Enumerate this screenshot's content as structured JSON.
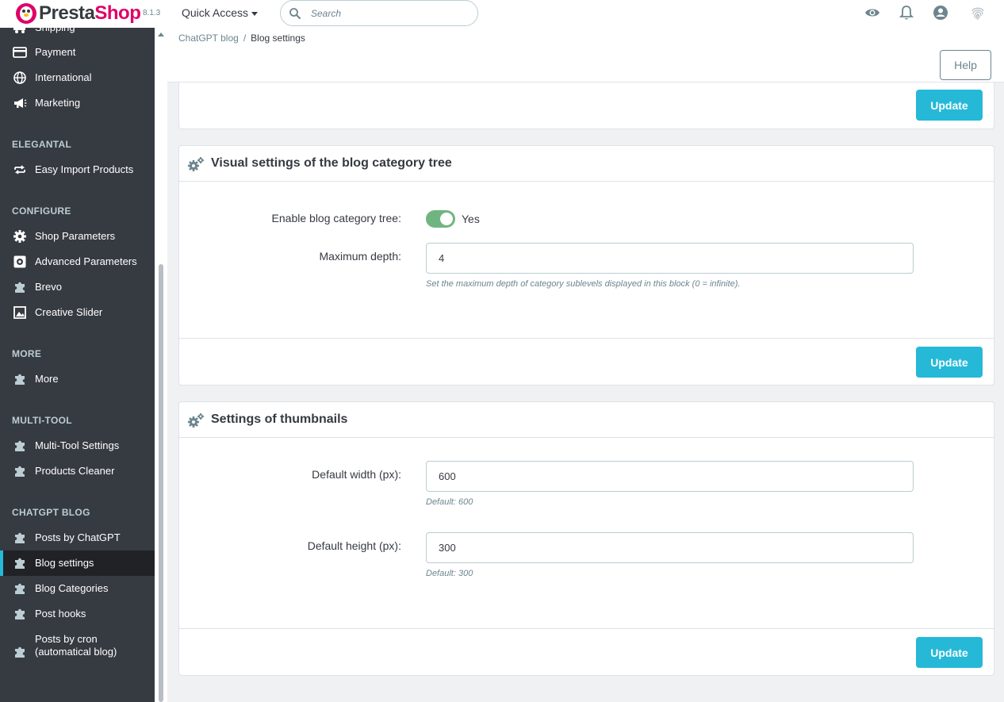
{
  "header": {
    "logo_part1": "Presta",
    "logo_part2": "Shop",
    "version": "8.1.3",
    "quick_access": "Quick Access",
    "search_placeholder": "Search",
    "icons": [
      "eye-icon",
      "bell-icon",
      "user-icon",
      "fingerprint-icon"
    ]
  },
  "sidebar": {
    "items_top": [
      {
        "label": "Shipping",
        "icon": "truck-icon"
      },
      {
        "label": "Payment",
        "icon": "credit-card-icon"
      },
      {
        "label": "International",
        "icon": "globe-icon"
      },
      {
        "label": "Marketing",
        "icon": "megaphone-icon"
      }
    ],
    "sections": {
      "elegantal": "ELEGANTAL",
      "configure": "CONFIGURE",
      "more": "MORE",
      "multitool": "MULTI-TOOL",
      "chatgpt": "CHATGPT BLOG"
    },
    "elegantal_items": [
      {
        "label": "Easy Import Products",
        "icon": "swap-icon"
      }
    ],
    "configure_items": [
      {
        "label": "Shop Parameters",
        "icon": "gear-icon"
      },
      {
        "label": "Advanced Parameters",
        "icon": "advanced-gear-icon"
      },
      {
        "label": "Brevo",
        "icon": "puzzle-icon"
      },
      {
        "label": "Creative Slider",
        "icon": "image-icon"
      }
    ],
    "more_items": [
      {
        "label": "More",
        "icon": "puzzle-icon"
      }
    ],
    "multitool_items": [
      {
        "label": "Multi-Tool Settings",
        "icon": "puzzle-icon"
      },
      {
        "label": "Products Cleaner",
        "icon": "puzzle-icon"
      }
    ],
    "chatgpt_items": [
      {
        "label": "Posts by ChatGPT",
        "icon": "puzzle-icon"
      },
      {
        "label": "Blog settings",
        "icon": "puzzle-icon",
        "active": true
      },
      {
        "label": "Blog Categories",
        "icon": "puzzle-icon"
      },
      {
        "label": "Post hooks",
        "icon": "puzzle-icon"
      },
      {
        "label_line1": "Posts by cron",
        "label_line2": "(automatical blog)",
        "icon": "puzzle-icon"
      }
    ]
  },
  "breadcrumb": {
    "parent": "ChatGPT blog",
    "separator": "/",
    "current": "Blog settings"
  },
  "toolbar": {
    "help_label": "Help"
  },
  "panels": {
    "top_update_label": "Update",
    "category_tree": {
      "title": "Visual settings of the blog category tree",
      "enable_label": "Enable blog category tree:",
      "enable_value": "Yes",
      "enabled": true,
      "depth_label": "Maximum depth:",
      "depth_value": "4",
      "depth_help": "Set the maximum depth of category sublevels displayed in this block (0 = infinite).",
      "update_label": "Update"
    },
    "thumbnails": {
      "title": "Settings of thumbnails",
      "width_label": "Default width (px):",
      "width_value": "600",
      "width_help": "Default: 600",
      "height_label": "Default height (px):",
      "height_value": "300",
      "height_help": "Default: 300",
      "update_label": "Update"
    }
  },
  "colors": {
    "accent": "#25b9d7",
    "brand": "#df0067",
    "sidebar_bg": "#363a41",
    "switch_on": "#70b580"
  }
}
